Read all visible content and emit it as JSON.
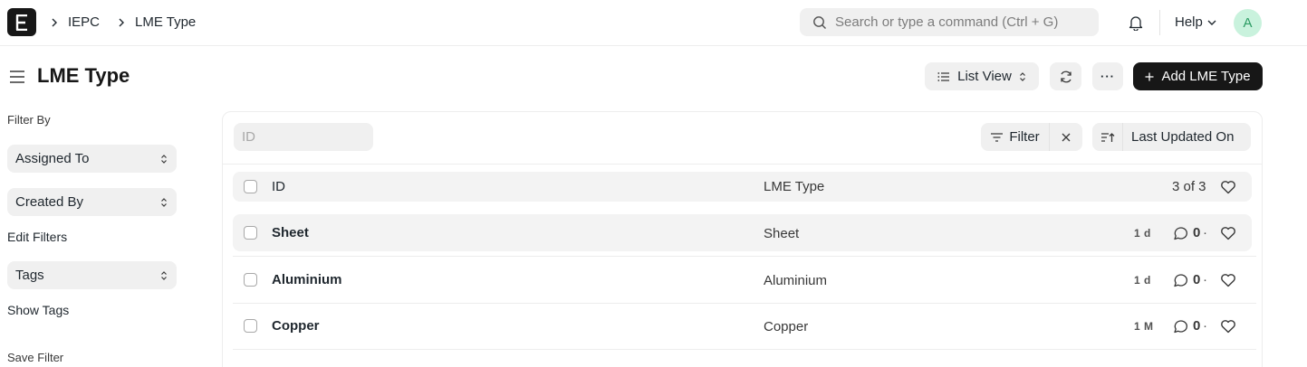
{
  "navbar": {
    "logo_letter": "E",
    "breadcrumbs": [
      "IEPC",
      "LME Type"
    ],
    "search_placeholder": "Search or type a command (Ctrl + G)",
    "help_label": "Help",
    "avatar_letter": "A"
  },
  "header": {
    "title": "LME Type",
    "list_view_label": "List View",
    "more_label": "···",
    "primary_label": "Add LME Type"
  },
  "sidebar": {
    "filter_by_label": "Filter By",
    "assigned_to_label": "Assigned To",
    "created_by_label": "Created By",
    "edit_filters_label": "Edit Filters",
    "tags_label": "Tags",
    "show_tags_label": "Show Tags",
    "save_filter_label": "Save Filter"
  },
  "list": {
    "id_placeholder": "ID",
    "filter_label": "Filter",
    "sort_label": "Last Updated On",
    "columns": {
      "id": "ID",
      "type": "LME Type"
    },
    "count_label": "3 of 3",
    "rows": [
      {
        "id": "Sheet",
        "type": "Sheet",
        "modified": "1 d",
        "comments": "0",
        "sep": "·"
      },
      {
        "id": "Aluminium",
        "type": "Aluminium",
        "modified": "1 d",
        "comments": "0",
        "sep": "·"
      },
      {
        "id": "Copper",
        "type": "Copper",
        "modified": "1 M",
        "comments": "0",
        "sep": "·"
      }
    ]
  },
  "colors": {
    "primary_button": "#171717",
    "control_bg": "#f0f0f0",
    "avatar_bg": "#c9f2dd",
    "avatar_text": "#2b9b63"
  }
}
